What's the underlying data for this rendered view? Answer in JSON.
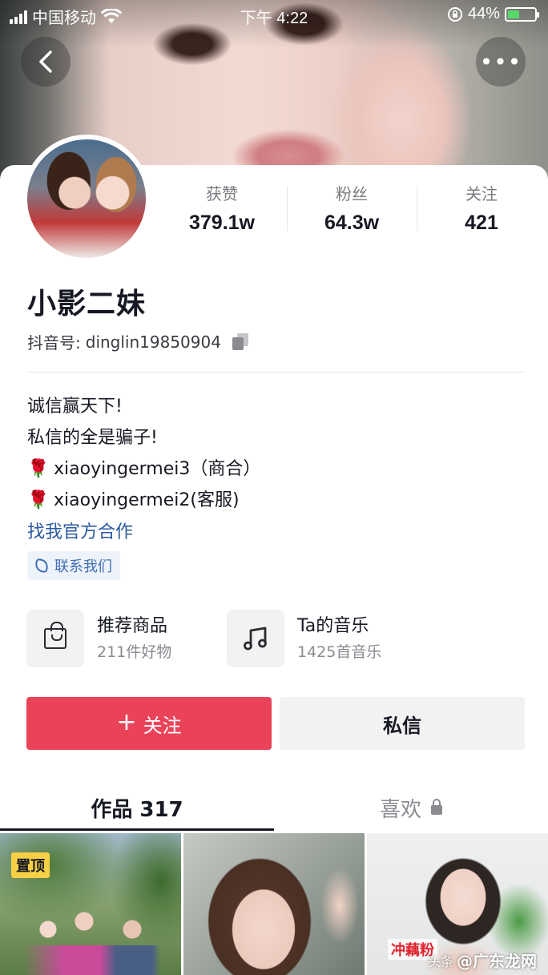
{
  "status_bar": {
    "carrier": "中国移动",
    "time": "下午 4:22",
    "battery": "44%"
  },
  "nav": {
    "back_icon": "chevron-left-icon",
    "more_icon": "more-dots-icon",
    "more_glyph": "•••"
  },
  "profile": {
    "name": "小影二妹",
    "douyin_id_label": "抖音号:",
    "douyin_id": "dinglin19850904",
    "stats": [
      {
        "label": "获赞",
        "value": "379.1w"
      },
      {
        "label": "粉丝",
        "value": "64.3w"
      },
      {
        "label": "关注",
        "value": "421"
      }
    ],
    "bio_lines": [
      "诚信赢天下!",
      "私信的全是骗子!"
    ],
    "bio_contacts": [
      {
        "icon": "rose-icon",
        "text": "xiaoyingermei3（商合）"
      },
      {
        "icon": "rose-icon",
        "text": "xiaoyingermei2(客服)"
      }
    ],
    "rose_glyph": "🌹",
    "link_text": "找我官方合作",
    "contact_button": "联系我们"
  },
  "features": [
    {
      "icon": "shopping-bag-icon",
      "title": "推荐商品",
      "subtitle": "211件好物"
    },
    {
      "icon": "music-note-icon",
      "title": "Ta的音乐",
      "subtitle": "1425首音乐"
    }
  ],
  "actions": {
    "follow_plus": "+",
    "follow": "关注",
    "message": "私信"
  },
  "tabs": {
    "works": "作品 317",
    "likes": "喜欢"
  },
  "thumbnails": [
    {
      "badge": "置顶"
    },
    {},
    {
      "caption": "冲藕粉"
    }
  ],
  "watermark": {
    "logo": "头条",
    "text": "@广东龙网"
  },
  "colors": {
    "follow_button": "#ea4359",
    "link": "#2c5aa0",
    "pin_badge": "#f7d046"
  }
}
